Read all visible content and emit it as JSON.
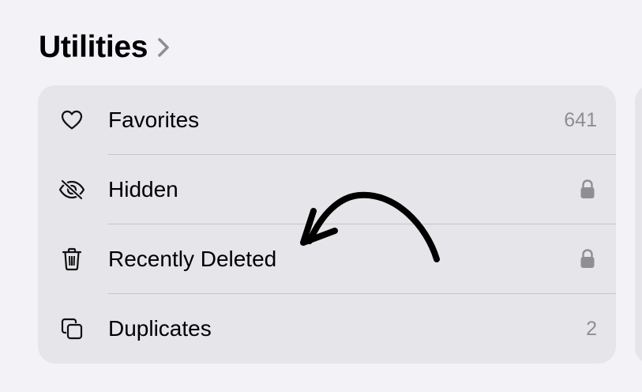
{
  "section": {
    "title": "Utilities"
  },
  "rows": [
    {
      "label": "Favorites",
      "value": "641",
      "icon": "heart-icon"
    },
    {
      "label": "Hidden",
      "value": "",
      "icon": "eye-slash-icon",
      "locked": true
    },
    {
      "label": "Recently Deleted",
      "value": "",
      "icon": "trash-icon",
      "locked": true
    },
    {
      "label": "Duplicates",
      "value": "2",
      "icon": "duplicate-icon"
    }
  ],
  "colors": {
    "background": "#f2f2f7",
    "card": "#e5e5ea",
    "secondary_text": "#8e8e93",
    "separator": "#c6c6c8"
  }
}
